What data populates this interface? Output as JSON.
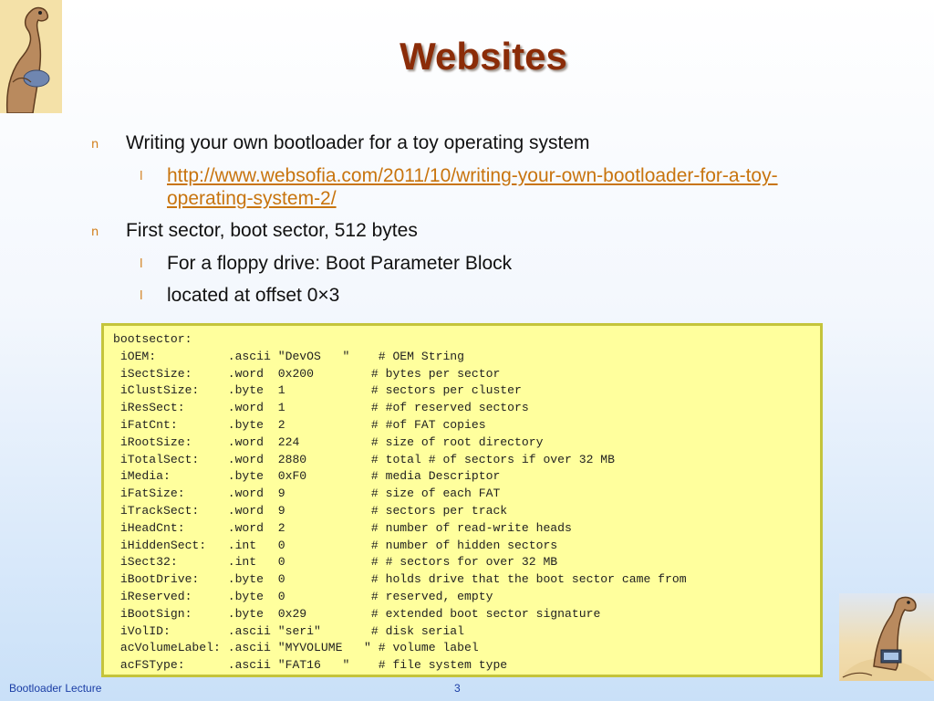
{
  "slide": {
    "title": "Websites",
    "bullets": [
      {
        "text": "Writing your own bootloader for a toy operating system",
        "sub": [
          {
            "link": "http://www.websofia.com/2011/10/writing-your-own-bootloader-for-a-toy-operating-system-2/"
          }
        ]
      },
      {
        "text": "First sector, boot sector, 512 bytes",
        "sub": [
          {
            "text": "For a floppy drive: Boot Parameter Block"
          },
          {
            "text": "located at offset 0×3"
          }
        ]
      }
    ],
    "code": "bootsector:\n iOEM:          .ascii \"DevOS   \"    # OEM String\n iSectSize:     .word  0x200        # bytes per sector\n iClustSize:    .byte  1            # sectors per cluster\n iResSect:      .word  1            # #of reserved sectors\n iFatCnt:       .byte  2            # #of FAT copies\n iRootSize:     .word  224          # size of root directory\n iTotalSect:    .word  2880         # total # of sectors if over 32 MB\n iMedia:        .byte  0xF0         # media Descriptor\n iFatSize:      .word  9            # size of each FAT\n iTrackSect:    .word  9            # sectors per track\n iHeadCnt:      .word  2            # number of read-write heads\n iHiddenSect:   .int   0            # number of hidden sectors\n iSect32:       .int   0            # # sectors for over 32 MB\n iBootDrive:    .byte  0            # holds drive that the boot sector came from\n iReserved:     .byte  0            # reserved, empty\n iBootSign:     .byte  0x29         # extended boot sector signature\n iVolID:        .ascii \"seri\"       # disk serial\n acVolumeLabel: .ascii \"MYVOLUME   \" # volume label\n acFSType:      .ascii \"FAT16   \"    # file system type"
  },
  "footer": {
    "course": "Bootloader Lecture",
    "page": "3"
  },
  "markers": {
    "level1": "n",
    "level2": "l"
  },
  "colors": {
    "title": "#8b2c08",
    "marker": "#d17b14",
    "link": "#c8740e",
    "code_bg": "#ffff9d",
    "code_border": "#c4c43b",
    "footer": "#1a3da5"
  }
}
